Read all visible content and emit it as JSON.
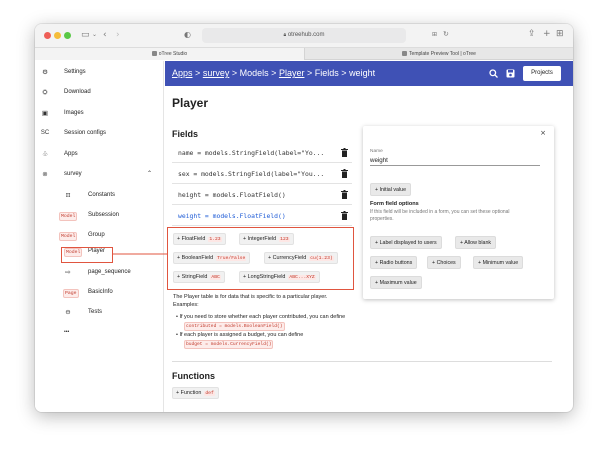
{
  "browser": {
    "url": "otreehub.com",
    "tabs": [
      {
        "label": "oTree Studio"
      },
      {
        "label": "Template Preview Tool | oTree"
      }
    ]
  },
  "sidebar": {
    "items": [
      {
        "label": "Settings",
        "icon": "gear-icon"
      },
      {
        "label": "Download",
        "icon": "download-icon"
      },
      {
        "label": "Images",
        "icon": "images-icon"
      },
      {
        "label": "Session configs",
        "icon": "sc",
        "icon_text": "SC"
      },
      {
        "label": "Apps",
        "icon": "apps-icon"
      },
      {
        "label": "survey",
        "icon": "app-icon"
      }
    ],
    "sub_items": [
      {
        "label": "Constants",
        "badge": "π"
      },
      {
        "label": "Subsession",
        "badge": "Model"
      },
      {
        "label": "Group",
        "badge": "Model"
      },
      {
        "label": "Player",
        "badge": "Model"
      },
      {
        "label": "page_sequence",
        "badge": "⇨"
      },
      {
        "label": "BasicInfo",
        "badge": "Page"
      },
      {
        "label": "Tests",
        "badge": "⊖"
      }
    ],
    "more": "•••"
  },
  "header": {
    "breadcrumb": [
      "Apps",
      "survey",
      "Models",
      "Player",
      "Fields",
      "weight"
    ],
    "separator": ">",
    "projects_label": "Projects"
  },
  "main": {
    "title": "Player",
    "fields_heading": "Fields",
    "fields": [
      "name = models.StringField(label=\"Yo...",
      "sex = models.StringField(label=\"You...",
      "height = models.FloatField()",
      "weight = models.FloatField()"
    ],
    "field_types": [
      {
        "label": "+ FloatField",
        "code": "1.23"
      },
      {
        "label": "+ IntegerField",
        "code": "123"
      },
      {
        "label": "+ BooleanField",
        "code": "True/False"
      },
      {
        "label": "+ CurrencyField",
        "code": "cu(1.23)"
      },
      {
        "label": "+ StringField",
        "code": "ABC"
      },
      {
        "label": "+ LongStringField",
        "code": "ABC...XYZ"
      }
    ],
    "description_line1": "The Player table is for data that is specific to a particular player.",
    "description_line2": "Examples:",
    "bullet1_text": "If you need to store whether each player contributed, you can define",
    "bullet1_code": "contributed = models.BooleanField()",
    "bullet2_text": "If each player is assigned a budget, you can define",
    "bullet2_code": "budget = models.CurrencyField()",
    "functions_heading": "Functions",
    "function_button": "+ Function",
    "function_code": "def"
  },
  "panel": {
    "name_label": "Name",
    "name_value": "weight",
    "initial_value_button": "+ Initial value",
    "form_options_heading": "Form field options",
    "form_options_desc_1": "If this field will be included in a form, you can set these optional",
    "form_options_desc_2": "properties.",
    "options": [
      "+ Label displayed to users",
      "+ Allow blank",
      "+ Radio buttons",
      "+ Choices",
      "+ Minimum value",
      "+ Maximum value"
    ],
    "close": "×"
  },
  "colors": {
    "header_bg": "#3f51b5",
    "highlight": "#e0553f",
    "selected_field": "#1e5bd6"
  }
}
